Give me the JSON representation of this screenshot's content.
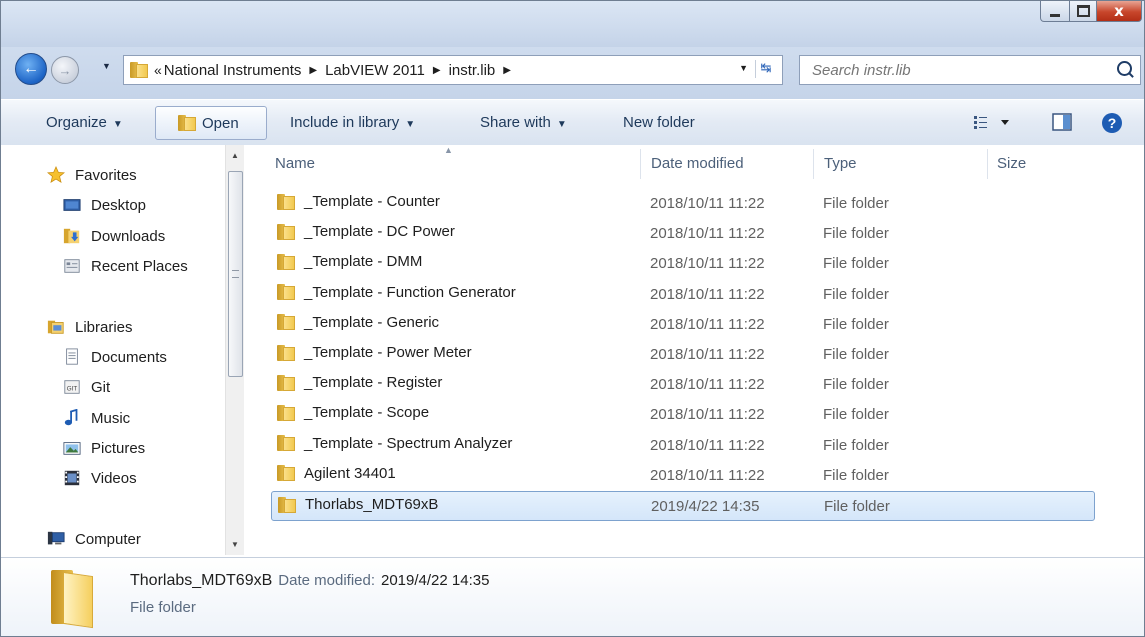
{
  "window": {
    "buttons": {
      "close": "x"
    }
  },
  "nav": {
    "breadcrumb": [
      "National Instruments",
      "LabVIEW 2011",
      "instr.lib"
    ],
    "overflow": "«",
    "search_placeholder": "Search instr.lib"
  },
  "toolbar": {
    "organize": "Organize",
    "open": "Open",
    "include_in_library": "Include in library",
    "share_with": "Share with",
    "new_folder": "New folder"
  },
  "sidebar": {
    "favorites": "Favorites",
    "favorites_items": [
      "Desktop",
      "Downloads",
      "Recent Places"
    ],
    "libraries": "Libraries",
    "libraries_items": [
      "Documents",
      "Git",
      "Music",
      "Pictures",
      "Videos"
    ],
    "computer": "Computer"
  },
  "columns": {
    "name": "Name",
    "date": "Date modified",
    "type": "Type",
    "size": "Size"
  },
  "files": [
    {
      "name": "_Template - Counter",
      "date": "2018/10/11 11:22",
      "type": "File folder"
    },
    {
      "name": "_Template - DC Power",
      "date": "2018/10/11 11:22",
      "type": "File folder"
    },
    {
      "name": "_Template - DMM",
      "date": "2018/10/11 11:22",
      "type": "File folder"
    },
    {
      "name": "_Template - Function Generator",
      "date": "2018/10/11 11:22",
      "type": "File folder"
    },
    {
      "name": "_Template - Generic",
      "date": "2018/10/11 11:22",
      "type": "File folder"
    },
    {
      "name": "_Template - Power Meter",
      "date": "2018/10/11 11:22",
      "type": "File folder"
    },
    {
      "name": "_Template - Register",
      "date": "2018/10/11 11:22",
      "type": "File folder"
    },
    {
      "name": "_Template - Scope",
      "date": "2018/10/11 11:22",
      "type": "File folder"
    },
    {
      "name": "_Template - Spectrum Analyzer",
      "date": "2018/10/11 11:22",
      "type": "File folder"
    },
    {
      "name": "Agilent 34401",
      "date": "2018/10/11 11:22",
      "type": "File folder"
    },
    {
      "name": "Thorlabs_MDT69xB",
      "date": "2019/4/22 14:35",
      "type": "File folder"
    }
  ],
  "selected_index": 10,
  "details": {
    "name": "Thorlabs_MDT69xB",
    "date_label": "Date modified:",
    "date_value": "2019/4/22 14:35",
    "type": "File folder"
  },
  "colors": {
    "accent": "#1d64c6",
    "selection": "#d4e6fa",
    "selection_border": "#7da2ce"
  }
}
